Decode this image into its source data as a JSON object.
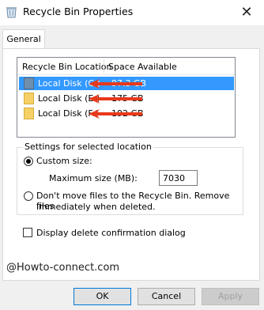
{
  "window": {
    "title": "Recycle Bin Properties",
    "close_glyph": "✕"
  },
  "tabs": [
    {
      "label": "General",
      "selected": true
    }
  ],
  "location_list": {
    "columns": [
      "Recycle Bin Location",
      "Space Available"
    ],
    "rows": [
      {
        "location": "Local Disk (C:)",
        "space": "97.3 GB",
        "selected": true
      },
      {
        "location": "Local Disk (E:)",
        "space": "175 GB",
        "selected": false
      },
      {
        "location": "Local Disk (F:)",
        "space": "192 GB",
        "selected": false
      }
    ]
  },
  "settings": {
    "legend": "Settings for selected location",
    "custom_size_label": "Custom size:",
    "custom_size_checked": true,
    "max_size_label": "Maximum size (MB):",
    "max_size_value": "7030",
    "dont_move_line1": "Don't move files to the Recycle Bin. Remove files",
    "dont_move_line2": "immediately when deleted.",
    "dont_move_checked": false
  },
  "confirm_dialog": {
    "label": "Display delete confirmation dialog",
    "checked": false
  },
  "watermark": "@Howto-connect.com",
  "buttons": {
    "ok": "OK",
    "cancel": "Cancel",
    "apply": "Apply"
  },
  "colors": {
    "selection": "#3399ff",
    "arrow": "#e8391a",
    "folder": "#f5d067"
  },
  "icons": {
    "title": "recycle-bin-icon",
    "row": "drive-folder-icon",
    "annotation": "red-arrow-icon"
  }
}
